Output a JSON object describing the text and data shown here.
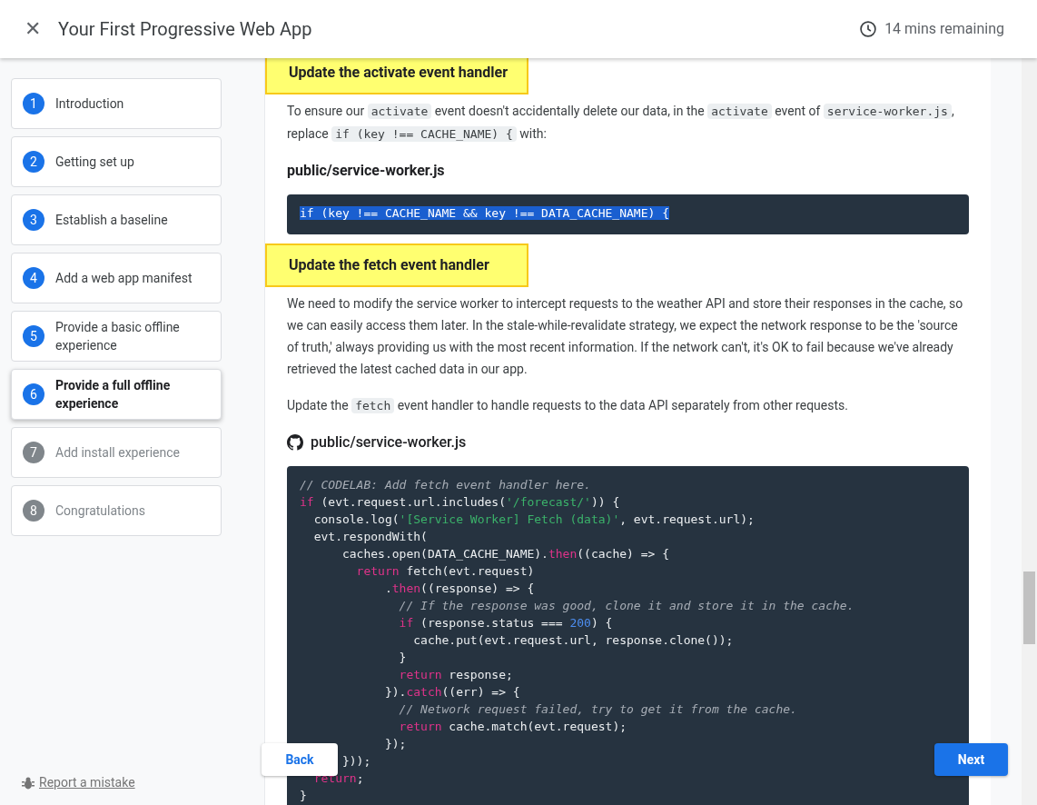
{
  "header": {
    "close": "✕",
    "title": "Your First Progressive Web App",
    "time_left": "14 mins remaining"
  },
  "steps": [
    {
      "number": "1",
      "label": "Introduction",
      "selected": false,
      "visited": true
    },
    {
      "number": "2",
      "label": "Getting set up",
      "selected": false,
      "visited": true
    },
    {
      "number": "3",
      "label": "Establish a baseline",
      "selected": false,
      "visited": true
    },
    {
      "number": "4",
      "label": "Add a web app manifest",
      "selected": false,
      "visited": true
    },
    {
      "number": "5",
      "label": "Provide a basic offline experience",
      "selected": false,
      "visited": true
    },
    {
      "number": "6",
      "label": "Provide a full offline experience",
      "selected": true,
      "visited": true
    },
    {
      "number": "7",
      "label": "Add install experience",
      "selected": false,
      "visited": false
    },
    {
      "number": "8",
      "label": "Congratulations",
      "selected": false,
      "visited": false
    }
  ],
  "report_link": "Report a mistake",
  "content": [
    {
      "kind": "heading",
      "text": "Update the activate event handler"
    },
    {
      "kind": "paragraph",
      "segments": [
        {
          "kind": "text",
          "text": "To ensure our "
        },
        {
          "kind": "code",
          "text": "activate"
        },
        {
          "kind": "text",
          "text": " event doesn't accidentally delete our data, in the "
        },
        {
          "kind": "code",
          "text": "activate"
        },
        {
          "kind": "text",
          "text": " event of "
        },
        {
          "kind": "code",
          "text": "service-worker.js"
        },
        {
          "kind": "text",
          "text": ", replace "
        },
        {
          "kind": "code",
          "text": "if (key !== CACHE_NAME) {"
        },
        {
          "kind": "text",
          "text": " with:"
        }
      ]
    },
    {
      "kind": "file",
      "text": "public/service-worker.js",
      "github": false
    },
    {
      "kind": "code",
      "selected": true,
      "lines": [
        [
          {
            "kind": "plain",
            "text": "if (key !== CACHE_NAME && key !== DATA_CACHE_NAME) {"
          }
        ]
      ]
    },
    {
      "kind": "heading",
      "text": "Update the fetch event handler"
    },
    {
      "kind": "paragraph",
      "segments": [
        {
          "kind": "text",
          "text": "We need to modify the service worker to intercept requests to the weather API and store their responses in the cache, so we can easily access them later. In the stale-while-revalidate strategy, we expect the network response to be the 'source of truth,' always providing us with the most recent information. If the network can't, it's OK to fail because we've already retrieved the latest cached data in our app."
        }
      ]
    },
    {
      "kind": "paragraph",
      "segments": [
        {
          "kind": "text",
          "text": "Update the "
        },
        {
          "kind": "code",
          "text": "fetch"
        },
        {
          "kind": "text",
          "text": " event handler to handle requests to the data API separately from other requests."
        }
      ]
    },
    {
      "kind": "file",
      "text": "public/service-worker.js",
      "github": true
    },
    {
      "kind": "code",
      "selected": false,
      "lines": [
        [
          {
            "kind": "comment",
            "text": "// CODELAB: Add fetch event handler here."
          }
        ],
        [
          {
            "kind": "keyword",
            "text": "if"
          },
          {
            "kind": "plain",
            "text": " (evt.request.url.includes("
          },
          {
            "kind": "string",
            "text": "'/forecast/'"
          },
          {
            "kind": "plain",
            "text": ")) {"
          }
        ],
        [
          {
            "kind": "plain",
            "text": "  console.log("
          },
          {
            "kind": "string",
            "text": "'[Service Worker] Fetch (data)'"
          },
          {
            "kind": "plain",
            "text": ", evt.request.url);"
          }
        ],
        [
          {
            "kind": "plain",
            "text": "  evt.respondWith("
          }
        ],
        [
          {
            "kind": "plain",
            "text": "      caches.open(DATA_CACHE_NAME)."
          },
          {
            "kind": "keyword",
            "text": "then"
          },
          {
            "kind": "plain",
            "text": "((cache) => {"
          }
        ],
        [
          {
            "kind": "keyword",
            "text": "        return"
          },
          {
            "kind": "plain",
            "text": " fetch(evt.request)"
          }
        ],
        [
          {
            "kind": "plain",
            "text": "            ."
          },
          {
            "kind": "keyword",
            "text": "then"
          },
          {
            "kind": "plain",
            "text": "((response) => {"
          }
        ],
        [
          {
            "kind": "comment",
            "text": "              // If the response was good, clone it and store it in the cache."
          }
        ],
        [
          {
            "kind": "keyword",
            "text": "              if"
          },
          {
            "kind": "plain",
            "text": " (response.status === "
          },
          {
            "kind": "number",
            "text": "200"
          },
          {
            "kind": "plain",
            "text": ") {"
          }
        ],
        [
          {
            "kind": "plain",
            "text": "                cache.put(evt.request.url, response.clone());"
          }
        ],
        [
          {
            "kind": "plain",
            "text": "              }"
          }
        ],
        [
          {
            "kind": "keyword",
            "text": "              return"
          },
          {
            "kind": "plain",
            "text": " response;"
          }
        ],
        [
          {
            "kind": "plain",
            "text": "            })."
          },
          {
            "kind": "keyword",
            "text": "catch"
          },
          {
            "kind": "plain",
            "text": "((err) => {"
          }
        ],
        [
          {
            "kind": "comment",
            "text": "              // Network request failed, try to get it from the cache."
          }
        ],
        [
          {
            "kind": "keyword",
            "text": "              return"
          },
          {
            "kind": "plain",
            "text": " cache.match(evt.request);"
          }
        ],
        [
          {
            "kind": "plain",
            "text": "            });"
          }
        ],
        [
          {
            "kind": "plain",
            "text": "      }));"
          }
        ],
        [
          {
            "kind": "keyword",
            "text": "  return"
          },
          {
            "kind": "plain",
            "text": ";"
          }
        ],
        [
          {
            "kind": "plain",
            "text": "}"
          }
        ]
      ]
    }
  ],
  "nav": {
    "back": "Back",
    "next": "Next"
  }
}
